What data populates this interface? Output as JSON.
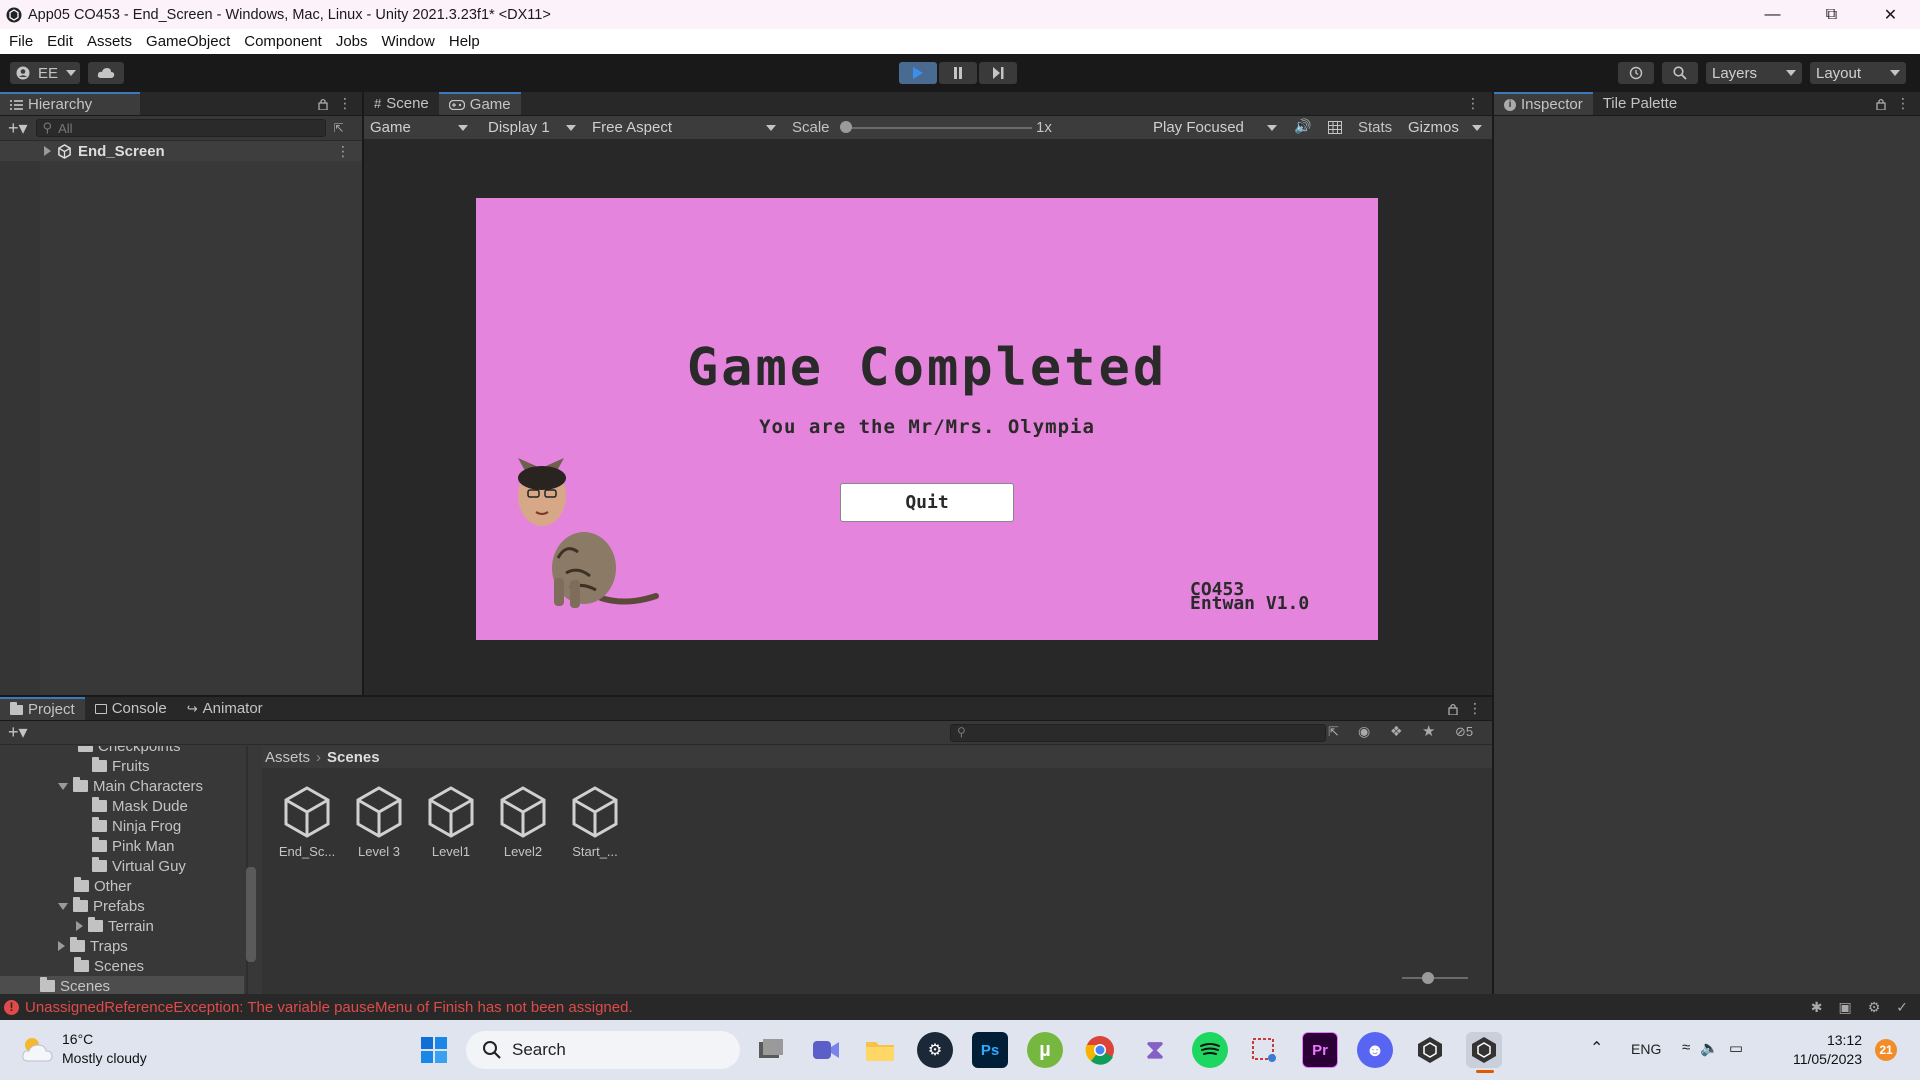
{
  "window": {
    "title": "App05 CO453 - End_Screen - Windows, Mac, Linux - Unity 2021.3.23f1* <DX11>"
  },
  "menu": [
    "File",
    "Edit",
    "Assets",
    "GameObject",
    "Component",
    "Jobs",
    "Window",
    "Help"
  ],
  "toolbar": {
    "account": "EE",
    "layers": "Layers",
    "layout": "Layout"
  },
  "hierarchy": {
    "tab": "Hierarchy",
    "search_placeholder": "All",
    "root_item": "End_Screen"
  },
  "scene_tabs": [
    "Scene",
    "Game"
  ],
  "game_toolbar": {
    "mode": "Game",
    "display": "Display 1",
    "aspect": "Free Aspect",
    "scale_label": "Scale",
    "scale_value": "1x",
    "play_mode": "Play Focused",
    "stats": "Stats",
    "gizmos": "Gizmos"
  },
  "game_screen": {
    "title": "Game Completed",
    "subtitle": "You are the Mr/Mrs. Olympia",
    "quit_button": "Quit",
    "credit_line1": "CO453",
    "credit_line2": "Entwan V1.0"
  },
  "inspector_tabs": [
    "Inspector",
    "Tile Palette"
  ],
  "bottom_tabs": [
    "Project",
    "Console",
    "Animator"
  ],
  "project": {
    "hidden_count": "5",
    "tree": [
      {
        "label": "Checkpoints",
        "indent": 3,
        "type": "folder"
      },
      {
        "label": "Fruits",
        "indent": 3,
        "type": "folder"
      },
      {
        "label": "Main Characters",
        "indent": 2,
        "type": "folder-open"
      },
      {
        "label": "Mask Dude",
        "indent": 3,
        "type": "folder"
      },
      {
        "label": "Ninja Frog",
        "indent": 3,
        "type": "folder"
      },
      {
        "label": "Pink Man",
        "indent": 3,
        "type": "folder"
      },
      {
        "label": "Virtual Guy",
        "indent": 3,
        "type": "folder"
      },
      {
        "label": "Other",
        "indent": 2,
        "type": "folder"
      },
      {
        "label": "Prefabs",
        "indent": 2,
        "type": "folder-open"
      },
      {
        "label": "Terrain",
        "indent": 3,
        "type": "folder-closed"
      },
      {
        "label": "Traps",
        "indent": 2,
        "type": "folder-closed"
      },
      {
        "label": "Scenes",
        "indent": 2,
        "type": "folder"
      },
      {
        "label": "Scenes",
        "indent": 1,
        "type": "folder"
      }
    ],
    "breadcrumb": [
      "Assets",
      "Scenes"
    ],
    "assets": [
      "End_Sc...",
      "Level 3",
      "Level1",
      "Level2",
      "Start_..."
    ]
  },
  "status": {
    "error": "UnassignedReferenceException: The variable pauseMenu of Finish has not been assigned."
  },
  "taskbar": {
    "temperature": "16°C",
    "weather": "Mostly cloudy",
    "search": "Search",
    "language": "ENG",
    "time": "13:12",
    "date": "11/05/2023",
    "notifications": "21",
    "pinned_apps": [
      "start-icon",
      "search-icon",
      "task-view-icon",
      "meet-icon",
      "file-explorer-icon",
      "steam-icon",
      "photoshop-icon",
      "utorrent-icon",
      "chrome-icon",
      "visual-studio-icon",
      "spotify-icon",
      "snipping-tool-icon",
      "premiere-icon",
      "discord-icon",
      "unity-hub-icon",
      "unity-icon"
    ]
  },
  "colors": {
    "unity_bg": "#383838",
    "game_bg": "#e584dc",
    "accent": "#3a79bb",
    "error": "#e04a4a"
  }
}
